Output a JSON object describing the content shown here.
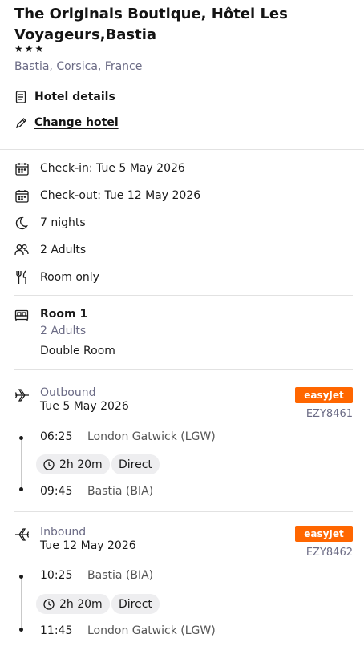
{
  "hotel": {
    "name": "The Originals Boutique, Hôtel Les Voyageurs,Bastia",
    "stars": "★★★",
    "location": "Bastia, Corsica, France"
  },
  "links": {
    "hotel_details": "Hotel details",
    "change_hotel": "Change hotel"
  },
  "stay": {
    "check_in": "Check-in: Tue 5 May 2026",
    "check_out": "Check-out: Tue 12 May 2026",
    "nights": "7 nights",
    "guests": "2 Adults",
    "board": "Room only"
  },
  "room": {
    "title": "Room 1",
    "adults": "2 Adults",
    "type": "Double Room"
  },
  "flights": [
    {
      "direction": "Outbound",
      "date": "Tue 5 May 2026",
      "airline": "easyJet",
      "flight_no": "EZY8461",
      "depart_time": "06:25",
      "depart_airport": "London Gatwick (LGW)",
      "duration": "2h 20m",
      "stops": "Direct",
      "arrive_time": "09:45",
      "arrive_airport": "Bastia (BIA)"
    },
    {
      "direction": "Inbound",
      "date": "Tue 12 May 2026",
      "airline": "easyJet",
      "flight_no": "EZY8462",
      "depart_time": "10:25",
      "depart_airport": "Bastia (BIA)",
      "duration": "2h 20m",
      "stops": "Direct",
      "arrive_time": "11:45",
      "arrive_airport": "London Gatwick (LGW)"
    }
  ],
  "colors": {
    "airline_brand": "#ff6600",
    "muted_text": "#6b6b85"
  }
}
